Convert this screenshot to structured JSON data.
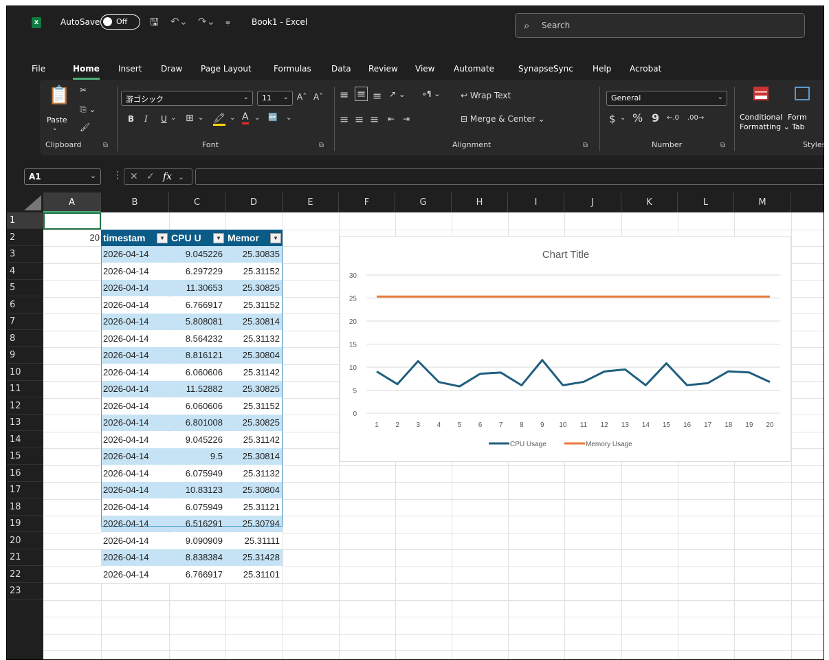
{
  "titlebar": {
    "logo": "x",
    "autosave_label": "AutoSave",
    "toggle_label": "Off",
    "doc_title": "Book1 - Excel",
    "search_placeholder": "Search",
    "icons": [
      "excel-logo-icon",
      "save-icon",
      "undo-icon",
      "redo-icon",
      "customize-qat-icon",
      "search-icon"
    ]
  },
  "menu": {
    "tabs": [
      "File",
      "Home",
      "Insert",
      "Draw",
      "Page Layout",
      "Formulas",
      "Data",
      "Review",
      "View",
      "Automate",
      "SynapseSync",
      "Help",
      "Acrobat"
    ],
    "active": "Home"
  },
  "ribbon": {
    "clipboard": {
      "label": "Clipboard",
      "paste": "Paste"
    },
    "font": {
      "label": "Font",
      "font_name": "游ゴシック",
      "font_size": "11",
      "bold": "B",
      "italic": "I",
      "underline": "U",
      "grow": "A^",
      "shrink": "Aˇ"
    },
    "alignment": {
      "label": "Alignment",
      "wrap_text": "Wrap Text",
      "merge_center": "Merge & Center"
    },
    "number": {
      "label": "Number",
      "format": "General",
      "currency": "$",
      "percent": "%",
      "comma": "9"
    },
    "styles": {
      "label": "Styles",
      "conditional": "Conditional",
      "formatting": "Formatting",
      "format_as": "Form",
      "table": "Tab"
    }
  },
  "formula_bar": {
    "name_box": "A1",
    "fx": "fx",
    "value": ""
  },
  "grid": {
    "columns": [
      "A",
      "B",
      "C",
      "D",
      "E",
      "F",
      "G",
      "H",
      "I",
      "J",
      "K",
      "L",
      "M"
    ],
    "rows": [
      "1",
      "2",
      "3",
      "4",
      "5",
      "6",
      "7",
      "8",
      "9",
      "10",
      "11",
      "12",
      "13",
      "14",
      "15",
      "16",
      "17",
      "18",
      "19",
      "20",
      "21",
      "22",
      "23"
    ],
    "selected_cell": "A1",
    "a2_value": "20",
    "table_headers": [
      "timestam",
      "CPU U",
      "Memor"
    ],
    "table_rows": [
      [
        "2026-04-14",
        "9.045226",
        "25.30835"
      ],
      [
        "2026-04-14",
        "6.297229",
        "25.31152"
      ],
      [
        "2026-04-14",
        "11.30653",
        "25.30825"
      ],
      [
        "2026-04-14",
        "6.766917",
        "25.31152"
      ],
      [
        "2026-04-14",
        "5.808081",
        "25.30814"
      ],
      [
        "2026-04-14",
        "8.564232",
        "25.31132"
      ],
      [
        "2026-04-14",
        "8.816121",
        "25.30804"
      ],
      [
        "2026-04-14",
        "6.060606",
        "25.31142"
      ],
      [
        "2026-04-14",
        "11.52882",
        "25.30825"
      ],
      [
        "2026-04-14",
        "6.060606",
        "25.31152"
      ],
      [
        "2026-04-14",
        "6.801008",
        "25.30825"
      ],
      [
        "2026-04-14",
        "9.045226",
        "25.31142"
      ],
      [
        "2026-04-14",
        "9.5",
        "25.30814"
      ],
      [
        "2026-04-14",
        "6.075949",
        "25.31132"
      ],
      [
        "2026-04-14",
        "10.83123",
        "25.30804"
      ],
      [
        "2026-04-14",
        "6.075949",
        "25.31121"
      ],
      [
        "2026-04-14",
        "6.516291",
        "25.30794"
      ],
      [
        "2026-04-14",
        "9.090909",
        "25.31111"
      ],
      [
        "2026-04-14",
        "8.838384",
        "25.31428"
      ],
      [
        "2026-04-14",
        "6.766917",
        "25.31101"
      ]
    ]
  },
  "chart_data": {
    "type": "line",
    "title": "Chart Title",
    "categories": [
      "1",
      "2",
      "3",
      "4",
      "5",
      "6",
      "7",
      "8",
      "9",
      "10",
      "11",
      "12",
      "13",
      "14",
      "15",
      "16",
      "17",
      "18",
      "19",
      "20"
    ],
    "ylim": [
      0,
      30
    ],
    "yticks": [
      "0",
      "5",
      "10",
      "15",
      "20",
      "25",
      "30"
    ],
    "grid": true,
    "legend": "bottom",
    "series": [
      {
        "name": "CPU Usage",
        "color": "#1f5f7f",
        "values": [
          9.045226,
          6.297229,
          11.30653,
          6.766917,
          5.808081,
          8.564232,
          8.816121,
          6.060606,
          11.52882,
          6.060606,
          6.801008,
          9.045226,
          9.5,
          6.075949,
          10.83123,
          6.075949,
          6.516291,
          9.090909,
          8.838384,
          6.766917
        ]
      },
      {
        "name": "Memory Usage",
        "color": "#e8793a",
        "values": [
          25.30835,
          25.31152,
          25.30825,
          25.31152,
          25.30814,
          25.31132,
          25.30804,
          25.31142,
          25.30825,
          25.31152,
          25.30825,
          25.31142,
          25.30814,
          25.31132,
          25.30804,
          25.31121,
          25.30794,
          25.31111,
          25.31428,
          25.31101
        ]
      }
    ]
  }
}
